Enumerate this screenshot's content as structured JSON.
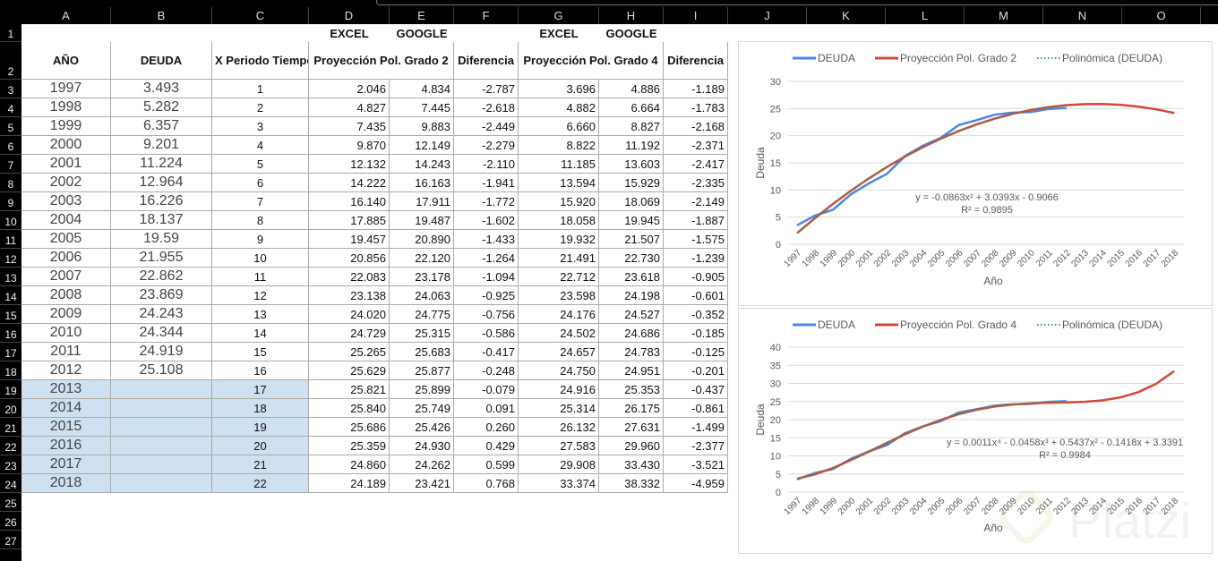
{
  "column_headers": [
    "A",
    "B",
    "C",
    "D",
    "E",
    "F",
    "G",
    "H",
    "I",
    "J",
    "K",
    "L",
    "M",
    "N",
    "O"
  ],
  "row_numbers": [
    "1",
    "2",
    "3",
    "4",
    "5",
    "6",
    "7",
    "8",
    "9",
    "10",
    "11",
    "12",
    "13",
    "14",
    "15",
    "16",
    "17",
    "18",
    "19",
    "20",
    "21",
    "22",
    "23",
    "24",
    "25",
    "26",
    "27"
  ],
  "sheet": {
    "row1": {
      "D": "EXCEL",
      "E": "GOOGLE",
      "G": "EXCEL",
      "H": "GOOGLE"
    },
    "headers": [
      "AÑO",
      "DEUDA",
      "X Periodo Tiempo",
      "Proyección Pol. Grado 2",
      "",
      "Diferencia",
      "Proyección Pol. Grado 4",
      "",
      "Diferencia"
    ],
    "rows": [
      [
        "1997",
        "3.493",
        "1",
        "2.046",
        "4.834",
        "-2.787",
        "3.696",
        "4.886",
        "-1.189"
      ],
      [
        "1998",
        "5.282",
        "2",
        "4.827",
        "7.445",
        "-2.618",
        "4.882",
        "6.664",
        "-1.783"
      ],
      [
        "1999",
        "6.357",
        "3",
        "7.435",
        "9.883",
        "-2.449",
        "6.660",
        "8.827",
        "-2.168"
      ],
      [
        "2000",
        "9.201",
        "4",
        "9.870",
        "12.149",
        "-2.279",
        "8.822",
        "11.192",
        "-2.371"
      ],
      [
        "2001",
        "11.224",
        "5",
        "12.132",
        "14.243",
        "-2.110",
        "11.185",
        "13.603",
        "-2.417"
      ],
      [
        "2002",
        "12.964",
        "6",
        "14.222",
        "16.163",
        "-1.941",
        "13.594",
        "15.929",
        "-2.335"
      ],
      [
        "2003",
        "16.226",
        "7",
        "16.140",
        "17.911",
        "-1.772",
        "15.920",
        "18.069",
        "-2.149"
      ],
      [
        "2004",
        "18.137",
        "8",
        "17.885",
        "19.487",
        "-1.602",
        "18.058",
        "19.945",
        "-1.887"
      ],
      [
        "2005",
        "19.59",
        "9",
        "19.457",
        "20.890",
        "-1.433",
        "19.932",
        "21.507",
        "-1.575"
      ],
      [
        "2006",
        "21.955",
        "10",
        "20.856",
        "22.120",
        "-1.264",
        "21.491",
        "22.730",
        "-1.239"
      ],
      [
        "2007",
        "22.862",
        "11",
        "22.083",
        "23.178",
        "-1.094",
        "22.712",
        "23.618",
        "-0.905"
      ],
      [
        "2008",
        "23.869",
        "12",
        "23.138",
        "24.063",
        "-0.925",
        "23.598",
        "24.198",
        "-0.601"
      ],
      [
        "2009",
        "24.243",
        "13",
        "24.020",
        "24.775",
        "-0.756",
        "24.176",
        "24.527",
        "-0.352"
      ],
      [
        "2010",
        "24.344",
        "14",
        "24.729",
        "25.315",
        "-0.586",
        "24.502",
        "24.686",
        "-0.185"
      ],
      [
        "2011",
        "24.919",
        "15",
        "25.265",
        "25.683",
        "-0.417",
        "24.657",
        "24.783",
        "-0.125"
      ],
      [
        "2012",
        "25.108",
        "16",
        "25.629",
        "25.877",
        "-0.248",
        "24.750",
        "24.951",
        "-0.201"
      ],
      [
        "2013",
        "",
        "17",
        "25.821",
        "25.899",
        "-0.079",
        "24.916",
        "25.353",
        "-0.437"
      ],
      [
        "2014",
        "",
        "18",
        "25.840",
        "25.749",
        "0.091",
        "25.314",
        "26.175",
        "-0.861"
      ],
      [
        "2015",
        "",
        "19",
        "25.686",
        "25.426",
        "0.260",
        "26.132",
        "27.631",
        "-1.499"
      ],
      [
        "2016",
        "",
        "20",
        "25.359",
        "24.930",
        "0.429",
        "27.583",
        "29.960",
        "-2.377"
      ],
      [
        "2017",
        "",
        "21",
        "24.860",
        "24.262",
        "0.599",
        "29.908",
        "33.430",
        "-3.521"
      ],
      [
        "2018",
        "",
        "22",
        "24.189",
        "23.421",
        "0.768",
        "33.374",
        "38.332",
        "-4.959"
      ]
    ]
  },
  "colors": {
    "deuda": "#4a86e8",
    "projection": "#d9453a",
    "trend": "#3c9a48",
    "selection": "#cfe0f1"
  },
  "chart_data": [
    {
      "type": "line",
      "categories": [
        "1997",
        "1998",
        "1999",
        "2000",
        "2001",
        "2002",
        "2003",
        "2004",
        "2005",
        "2006",
        "2007",
        "2008",
        "2009",
        "2010",
        "2011",
        "2012",
        "2013",
        "2014",
        "2015",
        "2016",
        "2017",
        "2018"
      ],
      "series": [
        {
          "name": "DEUDA",
          "values": [
            3.493,
            5.282,
            6.357,
            9.201,
            11.224,
            12.964,
            16.226,
            18.137,
            19.59,
            21.955,
            22.862,
            23.869,
            24.243,
            24.344,
            24.919,
            25.108
          ]
        },
        {
          "name": "Proyección Pol. Grado 2",
          "values": [
            2.046,
            4.827,
            7.435,
            9.87,
            12.132,
            14.222,
            16.14,
            17.885,
            19.457,
            20.856,
            22.083,
            23.138,
            24.02,
            24.729,
            25.265,
            25.629,
            25.821,
            25.84,
            25.686,
            25.359,
            24.86,
            24.189
          ]
        },
        {
          "name": "Polinómica (DEUDA)",
          "trendline": "polynomial",
          "coefficients": [
            -0.9066,
            3.0393,
            -0.0863
          ]
        }
      ],
      "equation": "y = -0.0863x² + 3.0393x - 0.9066",
      "r2": "R² = 0.9895",
      "xlabel": "Año",
      "ylabel": "Deuda",
      "ylim": [
        0,
        30
      ],
      "yticks": [
        0,
        5,
        10,
        15,
        20,
        25,
        30
      ],
      "grid": true,
      "legend": "top"
    },
    {
      "type": "line",
      "categories": [
        "1997",
        "1998",
        "1999",
        "2000",
        "2001",
        "2002",
        "2003",
        "2004",
        "2005",
        "2006",
        "2007",
        "2008",
        "2009",
        "2010",
        "2011",
        "2012",
        "2013",
        "2014",
        "2015",
        "2016",
        "2017",
        "2018"
      ],
      "series": [
        {
          "name": "DEUDA",
          "values": [
            3.493,
            5.282,
            6.357,
            9.201,
            11.224,
            12.964,
            16.226,
            18.137,
            19.59,
            21.955,
            22.862,
            23.869,
            24.243,
            24.344,
            24.919,
            25.108
          ]
        },
        {
          "name": "Proyección Pol. Grado 4",
          "values": [
            3.696,
            4.882,
            6.66,
            8.822,
            11.185,
            13.594,
            15.92,
            18.058,
            19.932,
            21.491,
            22.712,
            23.598,
            24.176,
            24.502,
            24.657,
            24.75,
            24.916,
            25.314,
            26.132,
            27.583,
            29.908,
            33.374
          ]
        },
        {
          "name": "Polinómica (DEUDA)",
          "trendline": "polynomial",
          "coefficients": [
            3.3391,
            -0.1418,
            0.5437,
            -0.0458,
            0.0011
          ]
        }
      ],
      "equation": "y = 0.0011x⁴ - 0.0458x³ + 0.5437x² - 0.1418x + 3.3391",
      "r2": "R² = 0.9984",
      "xlabel": "Año",
      "ylabel": "Deuda",
      "ylim": [
        0,
        40
      ],
      "yticks": [
        0,
        5,
        10,
        15,
        20,
        25,
        30,
        35,
        40
      ],
      "grid": true,
      "legend": "top"
    }
  ],
  "watermark": "Platzi"
}
